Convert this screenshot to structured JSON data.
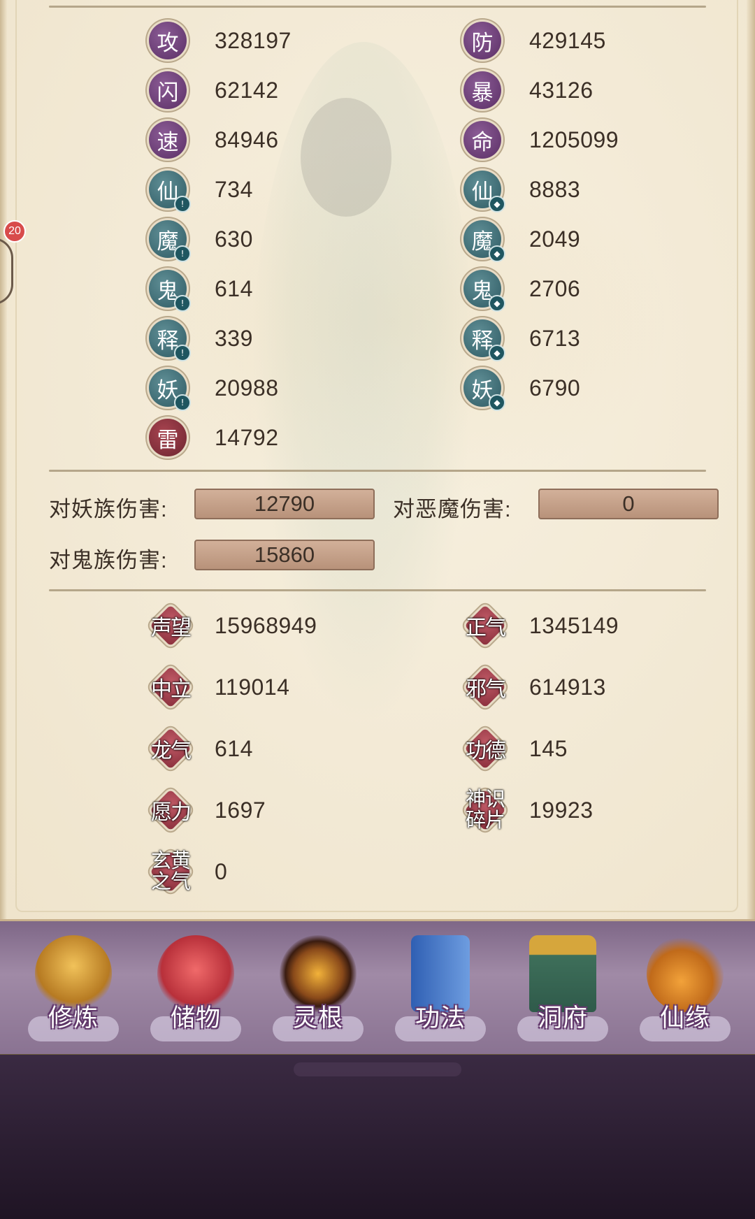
{
  "attributes": {
    "left": [
      {
        "icon": "攻",
        "value": "328197",
        "style": "purple",
        "badge": ""
      },
      {
        "icon": "闪",
        "value": "62142",
        "style": "purple",
        "badge": ""
      },
      {
        "icon": "速",
        "value": "84946",
        "style": "purple",
        "badge": ""
      },
      {
        "icon": "仙",
        "value": "734",
        "style": "teal",
        "badge": "!"
      },
      {
        "icon": "魔",
        "value": "630",
        "style": "teal",
        "badge": "!"
      },
      {
        "icon": "鬼",
        "value": "614",
        "style": "teal",
        "badge": "!"
      },
      {
        "icon": "释",
        "value": "339",
        "style": "teal",
        "badge": "!"
      },
      {
        "icon": "妖",
        "value": "20988",
        "style": "teal",
        "badge": "!"
      },
      {
        "icon": "雷",
        "value": "14792",
        "style": "red",
        "badge": ""
      }
    ],
    "right": [
      {
        "icon": "防",
        "value": "429145",
        "style": "purple",
        "badge": ""
      },
      {
        "icon": "暴",
        "value": "43126",
        "style": "purple",
        "badge": ""
      },
      {
        "icon": "命",
        "value": "1205099",
        "style": "purple",
        "badge": ""
      },
      {
        "icon": "仙",
        "value": "8883",
        "style": "teal",
        "badge": "◆"
      },
      {
        "icon": "魔",
        "value": "2049",
        "style": "teal",
        "badge": "◆"
      },
      {
        "icon": "鬼",
        "value": "2706",
        "style": "teal",
        "badge": "◆"
      },
      {
        "icon": "释",
        "value": "6713",
        "style": "teal",
        "badge": "◆"
      },
      {
        "icon": "妖",
        "value": "6790",
        "style": "teal",
        "badge": "◆"
      }
    ]
  },
  "damage": [
    {
      "label": "对妖族伤害:",
      "value": "12790"
    },
    {
      "label": "对恶魔伤害:",
      "value": "0"
    },
    {
      "label": "对鬼族伤害:",
      "value": "15860"
    }
  ],
  "reputation": {
    "left": [
      {
        "icon": "声望",
        "value": "15968949"
      },
      {
        "icon": "中立",
        "value": "119014"
      },
      {
        "icon": "龙气",
        "value": "614"
      },
      {
        "icon": "愿力",
        "value": "1697"
      },
      {
        "icon": "玄黄之气",
        "value": "0"
      }
    ],
    "right": [
      {
        "icon": "正气",
        "value": "1345149"
      },
      {
        "icon": "邪气",
        "value": "614913"
      },
      {
        "icon": "功德",
        "value": "145"
      },
      {
        "icon": "神识碎片",
        "value": "19923"
      }
    ]
  },
  "side": {
    "badge_count": "20"
  },
  "nav": [
    {
      "label": "修炼",
      "icon": "monk-icon"
    },
    {
      "label": "储物",
      "icon": "treasure-bag-icon"
    },
    {
      "label": "灵根",
      "icon": "spirit-root-icon"
    },
    {
      "label": "功法",
      "icon": "book-icon"
    },
    {
      "label": "洞府",
      "icon": "cave-palace-icon"
    },
    {
      "label": "仙缘",
      "icon": "gourd-icon"
    }
  ],
  "colors": {
    "accent": "#7e6787",
    "stat_purple": "#6e3f7a",
    "stat_teal": "#3f6d75",
    "stat_red": "#8a2f3c"
  }
}
